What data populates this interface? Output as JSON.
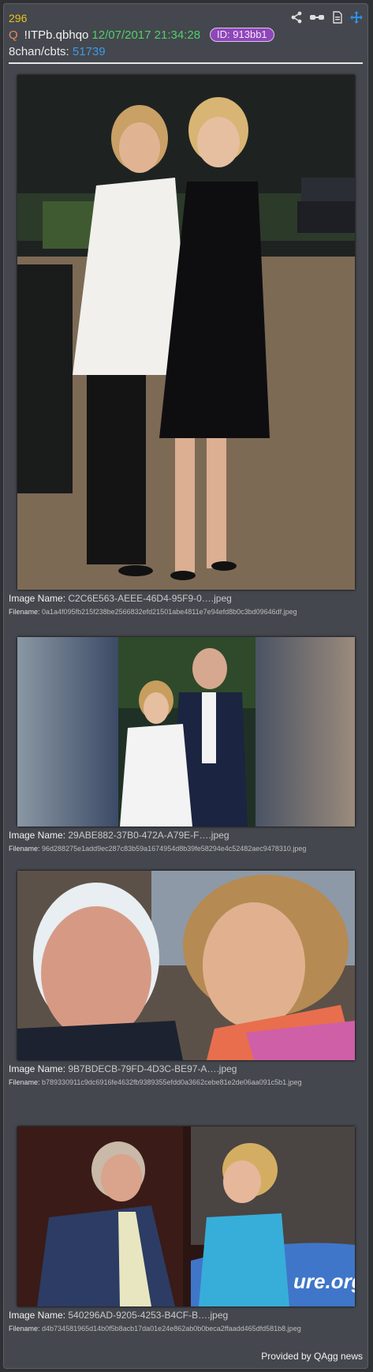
{
  "post": {
    "number": "296",
    "q_marker": "Q",
    "tripcode": "!ITPb.qbhqo",
    "datetime": "12/07/2017 21:34:28",
    "id_badge": "ID: 913bb1",
    "board_label": "8chan/cbts:",
    "board_post": "51739"
  },
  "icons": [
    "share-icon",
    "glasses-icon",
    "document-icon",
    "move-icon"
  ],
  "images": [
    {
      "name_label": "Image Name:",
      "name": "C2C6E563-AEEE-46D4-95F9-0….jpeg",
      "file_label": "Filename:",
      "filename": "0a1a4f095fb215f238be2566832efd21501abe4811e7e94efd8b0c3bd09646df.jpeg"
    },
    {
      "name_label": "Image Name:",
      "name": "29ABE882-37B0-472A-A79E-F….jpeg",
      "file_label": "Filename:",
      "filename": "96d288275e1add9ec287c83b59a1674954d8b39fe58294e4c52482aec9478310.jpeg"
    },
    {
      "name_label": "Image Name:",
      "name": "9B7BDECB-79FD-4D3C-BE97-A….jpeg",
      "file_label": "Filename:",
      "filename": "b789330911c9dc6916fe4632fb9389355efdd0a3662cebe81e2de06aa091c5b1.jpeg"
    },
    {
      "name_label": "Image Name:",
      "name": "540296AD-9205-4253-B4CF-B….jpeg",
      "file_label": "Filename:",
      "filename": "d4b734581965d14b0f5b8acb17da01e24e862ab0b0beca2ffaadd465dfd581b8.jpeg",
      "banner_text": "ure.org"
    }
  ],
  "footer": "Provided by QAgg news",
  "colors": {
    "post_number": "#e8c21a",
    "date": "#4fd06a",
    "id_badge": "#8e46b9",
    "board_num": "#3d9bea",
    "move_icon": "#2f8fe6"
  }
}
